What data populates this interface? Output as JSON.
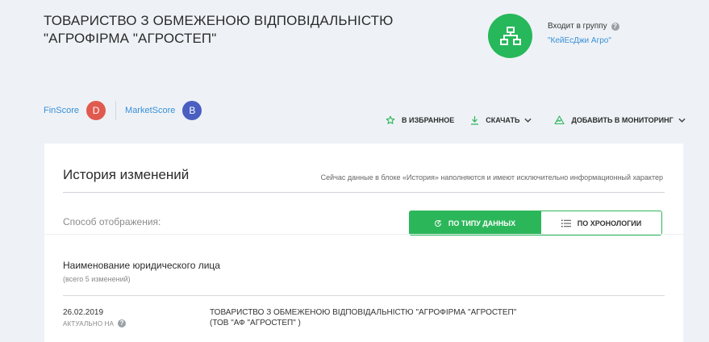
{
  "company": {
    "title": "ТОВАРИСТВО З ОБМЕЖЕНОЮ ВІДПОВІДАЛЬНІСТЮ \"АГРОФІРМА \"АГРОСТЕП\""
  },
  "group": {
    "label": "Входит в группу",
    "help_symbol": "?",
    "link": "\"КейЕсДжи Агро\"",
    "icon": "hierarchy-icon",
    "color": "#26b85a"
  },
  "scores": {
    "finscore": {
      "label": "FinScore",
      "grade": "D",
      "color": "#e05a4f"
    },
    "marketscore": {
      "label": "MarketScore",
      "grade": "B",
      "color": "#4a5fc1"
    }
  },
  "actions": {
    "favorite": "В ИЗБРАННОЕ",
    "download": "СКАЧАТЬ",
    "monitoring": "ДОБАВИТЬ В МОНИТОРИНГ"
  },
  "history": {
    "title": "История изменений",
    "note": "Сейчас данные в блоке «История» наполняются и имеют исключительно информационный характер",
    "display_mode_label": "Способ отображения:",
    "mode_by_type": "ПО ТИПУ ДАННЫХ",
    "mode_by_chronology": "ПО ХРОНОЛОГИИ",
    "section": {
      "title": "Наименование юридического лица",
      "subtitle": "(всего 5 изменений)",
      "entries": [
        {
          "date": "26.02.2019",
          "status": "АКТУАЛЬНО НА",
          "value_line1": "ТОВАРИСТВО З ОБМЕЖЕНОЮ ВІДПОВІДАЛЬНІСТЮ \"АГРОФІРМА \"АГРОСТЕП\"",
          "value_line2": "(ТОВ \"АФ \"АГРОСТЕП\" )"
        }
      ]
    }
  },
  "colors": {
    "accent_green": "#2cb65a",
    "link_blue": "#3a8fd6",
    "background": "#eef2f6"
  }
}
